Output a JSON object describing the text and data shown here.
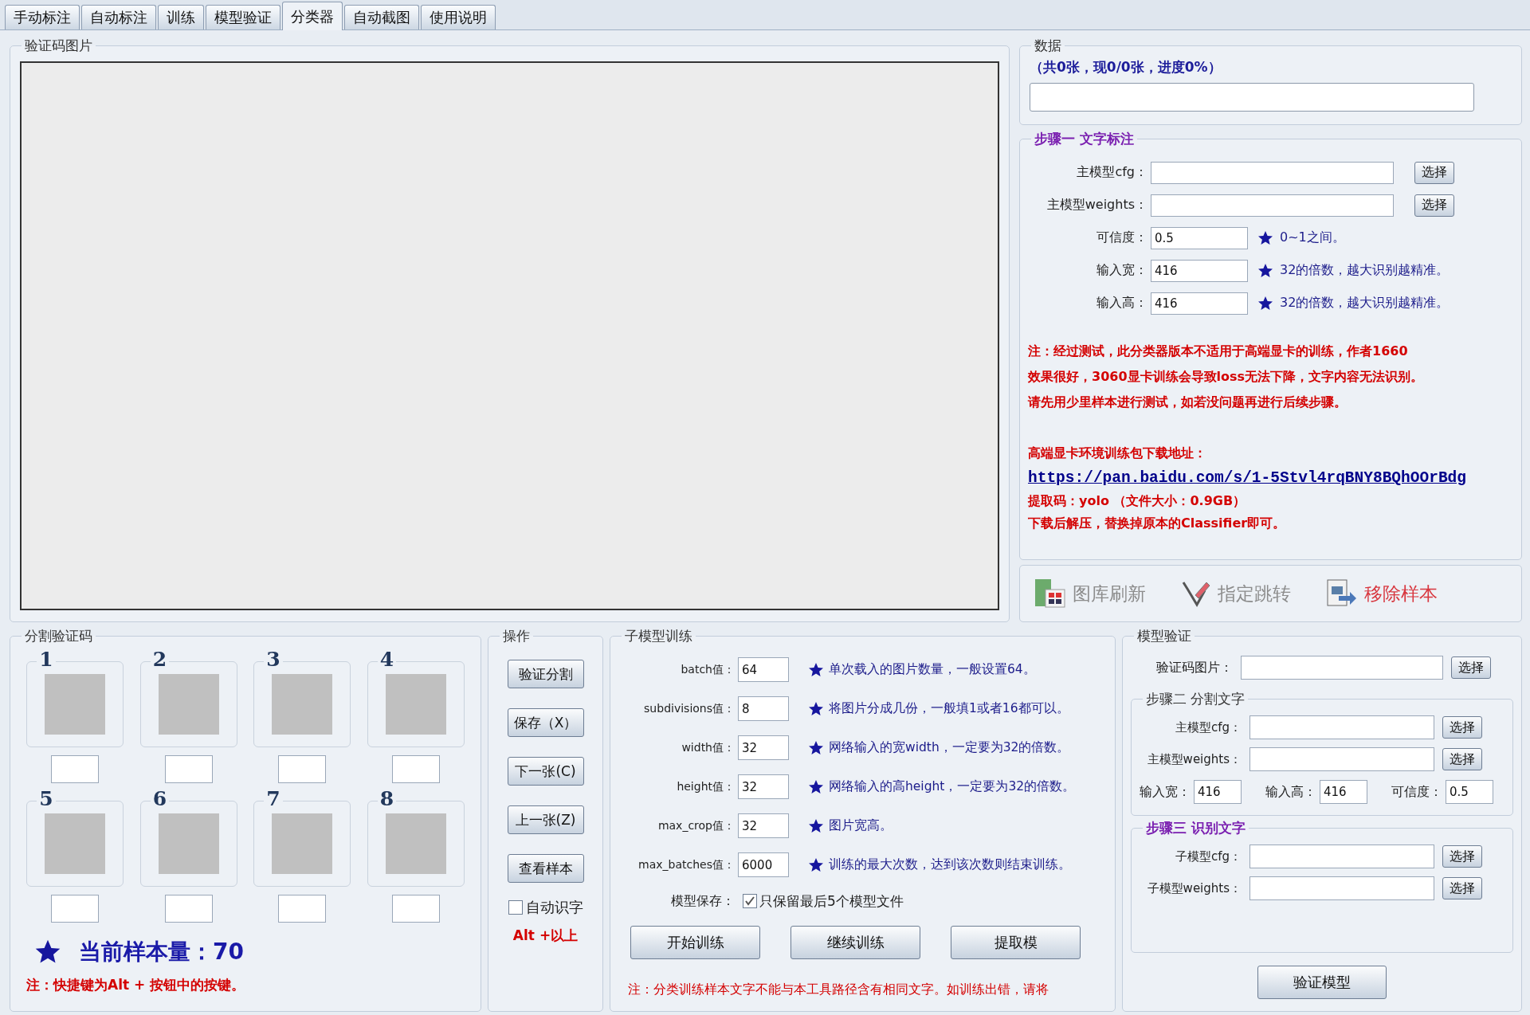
{
  "tabs": [
    {
      "label": "手动标注",
      "selected": false
    },
    {
      "label": "自动标注",
      "selected": false
    },
    {
      "label": "训练",
      "selected": false
    },
    {
      "label": "模型验证",
      "selected": false
    },
    {
      "label": "分类器",
      "selected": true
    },
    {
      "label": "自动截图",
      "selected": false
    },
    {
      "label": "使用说明",
      "selected": false
    }
  ],
  "captcha_panel": {
    "title": "验证码图片"
  },
  "data_panel": {
    "title": "数据",
    "progress_text": "（共0张，现0/0张，进度0%）",
    "progress": {
      "level": 0
    }
  },
  "step1": {
    "title": "步骤一  文字标注",
    "highlighted": true,
    "fields": [
      {
        "kind": "file",
        "label": "主模型cfg：",
        "button": "选择"
      },
      {
        "kind": "file",
        "label": "主模型weights：",
        "button": "选择"
      },
      {
        "kind": "short",
        "label": "可信度：",
        "value": "0.5",
        "hint": "0~1之间。"
      },
      {
        "kind": "short",
        "label": "输入宽：",
        "value": "416",
        "hint": "32的倍数，越大识别越精准。"
      },
      {
        "kind": "short",
        "label": "输入高：",
        "value": "416",
        "hint": "32的倍数，越大识别越精准。"
      }
    ],
    "notes": [
      "注：经过测试，此分类器版本不适用于高端显卡的训练，作者1660",
      "效果很好，3060显卡训练会导致loss无法下降，文字内容无法识别。",
      "请先用少里样本进行测试，如若没问题再进行后续步骤。"
    ],
    "download": {
      "heading": "高端显卡环境训练包下载地址：",
      "link": "https://pan.baidu.com/s/1-5Stvl4rqBNY8BQhOOrBdg",
      "code": "提取码：yolo （文件大小：0.9GB）",
      "instruction": "下载后解压，替换掉原本的Classifier即可。"
    }
  },
  "toolbar": [
    {
      "kind": "refresh",
      "label": "图库刷新",
      "disabled": true
    },
    {
      "kind": "jump",
      "label": "指定跳转",
      "disabled": true
    },
    {
      "kind": "remove",
      "label": "移除样本",
      "disabled": false
    }
  ],
  "segments": {
    "title": "分割验证码",
    "slots": [
      {
        "number": "1"
      },
      {
        "number": "2"
      },
      {
        "number": "3"
      },
      {
        "number": "4"
      },
      {
        "number": "5"
      },
      {
        "number": "6"
      },
      {
        "number": "7"
      },
      {
        "number": "8"
      }
    ],
    "sample_count": "当前样本量：70",
    "note": "注：快捷键为Alt + 按钮中的按键。"
  },
  "operations": {
    "title": "操作",
    "buttons": [
      "验证分割",
      "保存（X）",
      "下一张(C)",
      "上一张(Z)",
      "查看样本"
    ],
    "auto_recognize": {
      "label": "自动识字",
      "checked": false
    },
    "hint": "Alt +以上"
  },
  "sub_training": {
    "title": "子模型训练",
    "params": [
      {
        "label": "batch值：",
        "value": "64",
        "hint": "单次载入的图片数量，一般设置64。"
      },
      {
        "label": "subdivisions值：",
        "value": "8",
        "hint": "将图片分成几份，一般填1或者16都可以。"
      },
      {
        "label": "width值：",
        "value": "32",
        "hint": "网络输入的宽width，一定要为32的倍数。"
      },
      {
        "label": "height值：",
        "value": "32",
        "hint": "网络输入的高height，一定要为32的倍数。"
      },
      {
        "label": "max_crop值：",
        "value": "32",
        "hint": "图片宽高。"
      },
      {
        "label": "max_batches值：",
        "value": "6000",
        "hint": "训练的最大次数，达到该次数则结束训练。"
      }
    ],
    "save": {
      "label": "模型保存：",
      "option": "只保留最后5个模型文件",
      "checked": true
    },
    "buttons": [
      "开始训练",
      "继续训练",
      "提取模"
    ],
    "note": "注：分类训练样本文字不能与本工具路径含有相同文字。如训练出错，请将"
  },
  "model_validation": {
    "title": "模型验证",
    "image_field": {
      "label": "验证码图片：",
      "button": "选择"
    },
    "step2": {
      "title": "步骤二  分割文字",
      "highlighted": false,
      "fields": [
        {
          "label": "主模型cfg：",
          "button": "选择"
        },
        {
          "label": "主模型weights：",
          "button": "选择"
        }
      ],
      "small_fields": [
        {
          "label": "输入宽：",
          "value": "416"
        },
        {
          "label": "输入高：",
          "value": "416"
        },
        {
          "label": "可信度：",
          "value": "0.5"
        }
      ]
    },
    "step3": {
      "title": "步骤三  识别文字",
      "highlighted": true,
      "fields": [
        {
          "label": "子模型cfg：",
          "button": "选择"
        },
        {
          "label": "子模型weights：",
          "button": "选择"
        }
      ]
    },
    "button": "验证模型"
  }
}
